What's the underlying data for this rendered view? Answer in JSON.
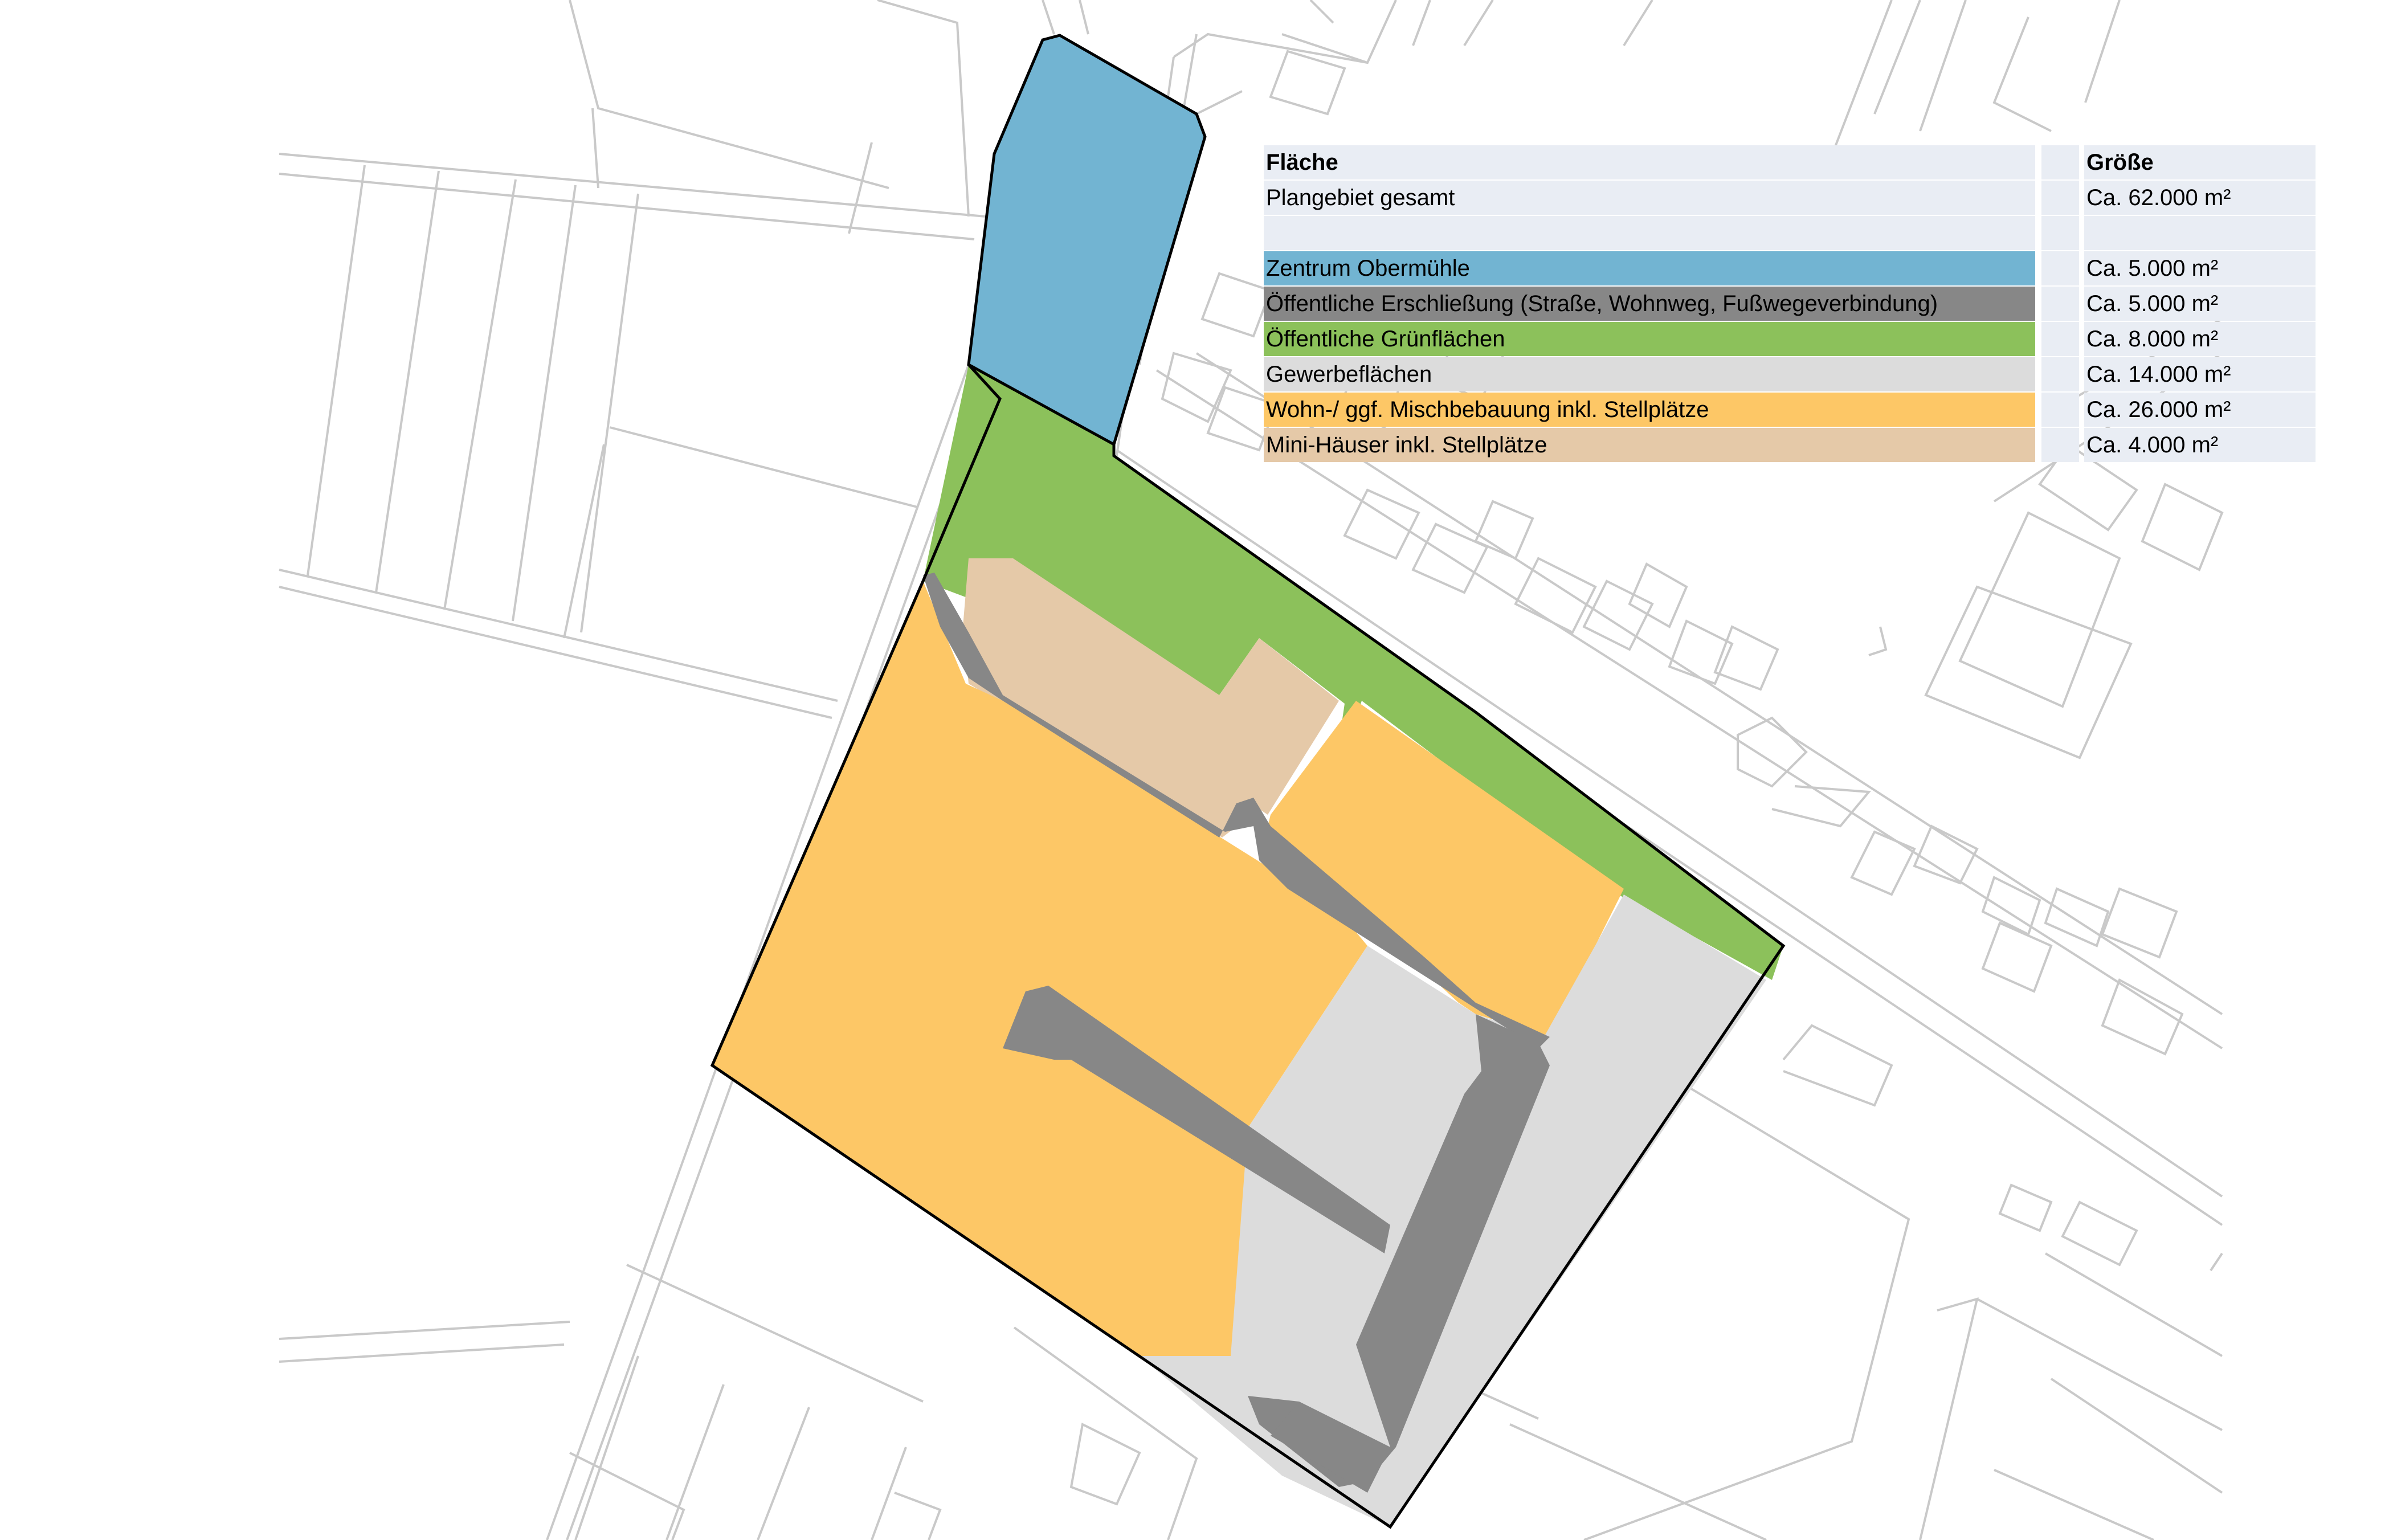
{
  "legend": {
    "header": {
      "label": "Fläche",
      "size": "Größe"
    },
    "total": {
      "label": "Plangebiet gesamt",
      "size": "Ca. 62.000 m²"
    },
    "rows": [
      {
        "label": "Zentrum Obermühle",
        "size": "Ca. 5.000 m²",
        "color": "#72b4d2"
      },
      {
        "label": "Öffentliche Erschließung (Straße, Wohnweg, Fußwegeverbindung)",
        "size": "Ca. 5.000 m²",
        "color": "#878787"
      },
      {
        "label": "Öffentliche Grünflächen",
        "size": "Ca. 8.000 m²",
        "color": "#8cc15b"
      },
      {
        "label": "Gewerbeflächen",
        "size": "Ca. 14.000 m²",
        "color": "#dcdcdc"
      },
      {
        "label": "Wohn-/ ggf. Mischbebauung inkl. Stellplätze",
        "size": "Ca. 26.000 m²",
        "color": "#fdc766"
      },
      {
        "label": "Mini-Häuser inkl. Stellplätze",
        "size": "Ca. 4.000 m²",
        "color": "#e5c9a8"
      }
    ]
  },
  "colors": {
    "base_lines": "#c8c8c8",
    "outline": "#000000",
    "label_bg": "#e9edf4"
  }
}
